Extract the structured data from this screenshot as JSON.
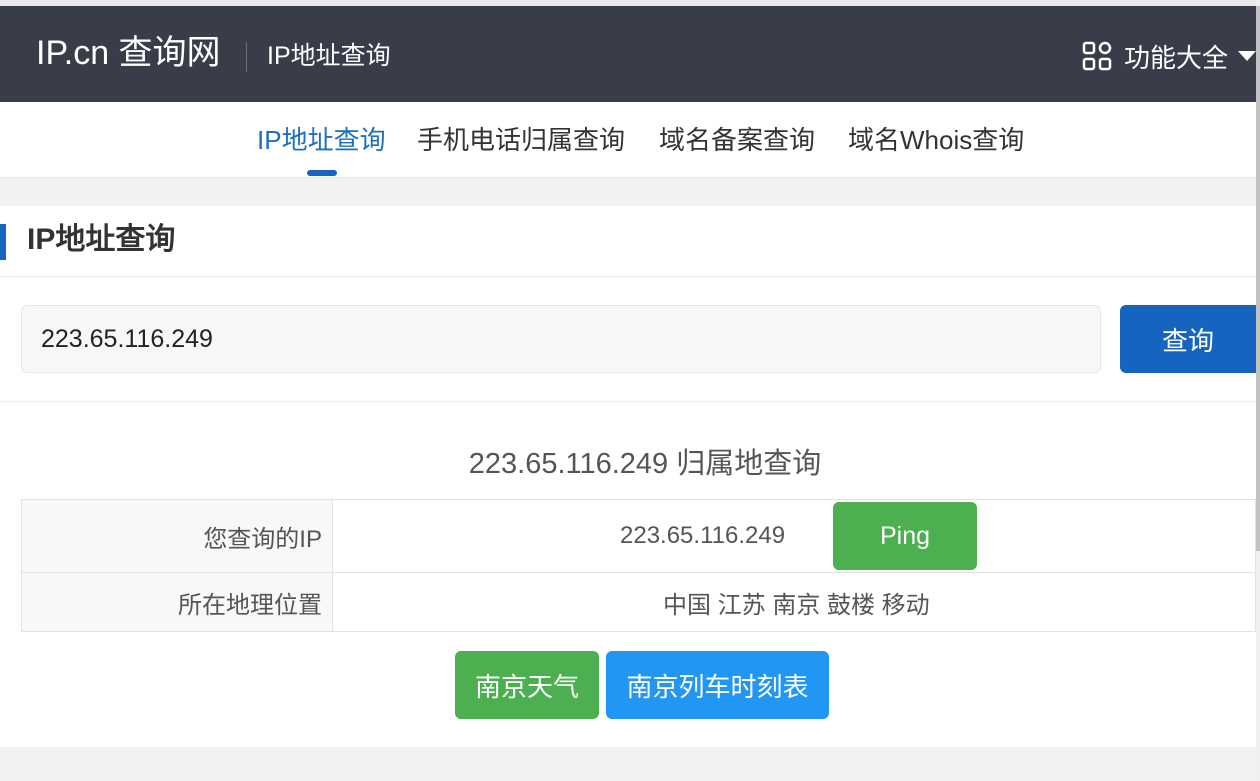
{
  "header": {
    "logo": "IP.cn 查询网",
    "subtitle": "IP地址查询",
    "menu_label": "功能大全",
    "menu_icon": "grid-icon"
  },
  "nav": {
    "tabs": [
      {
        "label": "IP地址查询",
        "active": true
      },
      {
        "label": "手机电话归属查询",
        "active": false
      },
      {
        "label": "域名备案查询",
        "active": false
      },
      {
        "label": "域名Whois查询",
        "active": false
      }
    ]
  },
  "card": {
    "title": "IP地址查询",
    "input_value": "223.65.116.249",
    "query_button": "查询",
    "result_title": "223.65.116.249 归属地查询",
    "rows": [
      {
        "label": "您查询的IP",
        "value": "223.65.116.249"
      },
      {
        "label": "所在地理位置",
        "value": "中国 江苏 南京 鼓楼 移动"
      }
    ],
    "ping_button": "Ping",
    "weather_button": "南京天气",
    "train_button": "南京列车时刻表"
  },
  "colors": {
    "header_bg": "#393d49",
    "accent": "#1565c0",
    "green": "#4caf50",
    "blue": "#2196f3"
  }
}
